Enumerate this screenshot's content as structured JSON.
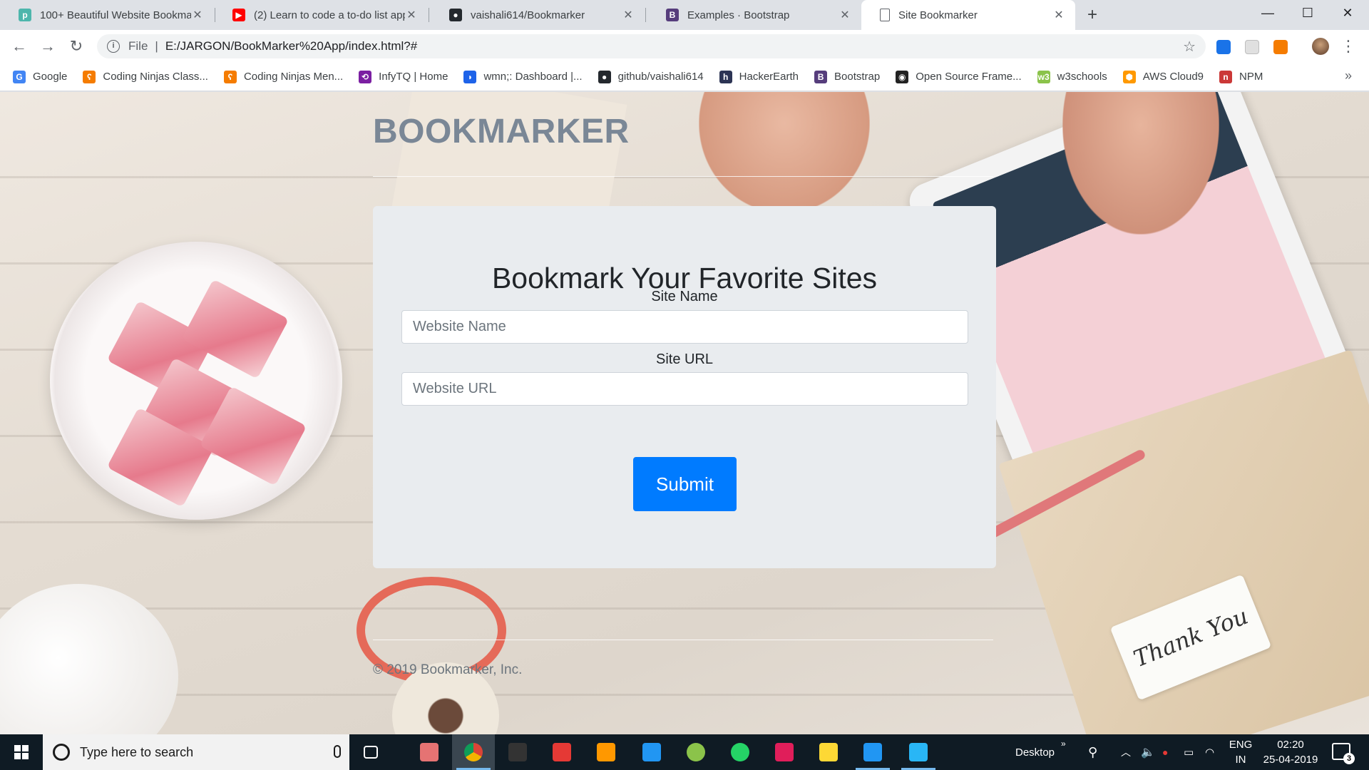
{
  "browser": {
    "tabs": [
      {
        "title": "100+ Beautiful Website Bookmar",
        "favicon": "portfolio-icon",
        "color": "#4db6ac",
        "glyph": "p",
        "active": false
      },
      {
        "title": "(2) Learn to code a to-do list app",
        "favicon": "youtube-icon",
        "color": "#ff0000",
        "glyph": "▶",
        "active": false
      },
      {
        "title": "vaishali614/Bookmarker",
        "favicon": "github-icon",
        "color": "#24292e",
        "glyph": "●",
        "active": false
      },
      {
        "title": "Examples · Bootstrap",
        "favicon": "bootstrap-icon",
        "color": "#563d7c",
        "glyph": "B",
        "active": false
      },
      {
        "title": "Site Bookmarker",
        "favicon": "page-icon",
        "color": "#ffffff",
        "glyph": "",
        "active": true
      }
    ],
    "new_tab": "+",
    "window_controls": {
      "minimize": "—",
      "maximize": "☐",
      "close": "✕"
    },
    "address": {
      "scheme": "File",
      "url": "E:/JARGON/BookMarker%20App/index.html?#"
    },
    "bookmarks": [
      {
        "label": "Google",
        "icon": "google-icon",
        "color": "#4285f4",
        "glyph": "G"
      },
      {
        "label": "Coding Ninjas Class...",
        "icon": "coding-ninjas-icon",
        "color": "#f57c00",
        "glyph": "ʕ"
      },
      {
        "label": "Coding Ninjas Men...",
        "icon": "coding-ninjas-icon",
        "color": "#f57c00",
        "glyph": "ʕ"
      },
      {
        "label": "InfyTQ | Home",
        "icon": "infytq-icon",
        "color": "#7b1fa2",
        "glyph": "⟲"
      },
      {
        "label": "wmn;: Dashboard |...",
        "icon": "wmn-icon",
        "color": "#1e63e9",
        "glyph": "◗"
      },
      {
        "label": "github/vaishali614",
        "icon": "github-icon",
        "color": "#24292e",
        "glyph": "●"
      },
      {
        "label": "HackerEarth",
        "icon": "hackerearth-icon",
        "color": "#2c3454",
        "glyph": "h"
      },
      {
        "label": "Bootstrap",
        "icon": "bootstrap-icon",
        "color": "#563d7c",
        "glyph": "B"
      },
      {
        "label": "Open Source Frame...",
        "icon": "opensource-icon",
        "color": "#222222",
        "glyph": "◉"
      },
      {
        "label": "w3schools",
        "icon": "w3schools-icon",
        "color": "#8bc34a",
        "glyph": "w3"
      },
      {
        "label": "AWS Cloud9",
        "icon": "aws-cloud9-icon",
        "color": "#ff9900",
        "glyph": "⬢"
      },
      {
        "label": "NPM",
        "icon": "npm-icon",
        "color": "#cb3837",
        "glyph": "n"
      }
    ],
    "bookmarks_more": "»"
  },
  "page": {
    "brand": "BOOKMARKER",
    "heading": "Bookmark Your Favorite Sites",
    "site_name_label": "Site Name",
    "site_name_placeholder": "Website Name",
    "site_url_label": "Site URL",
    "site_url_placeholder": "Website URL",
    "submit_label": "Submit",
    "footer": "© 2019 Bookmarker, Inc.",
    "tag_text": "Thank You",
    "colors": {
      "primary": "#007bff",
      "card": "#e9ecef",
      "brand_text": "#7a8796"
    }
  },
  "taskbar": {
    "search_placeholder": "Type here to search",
    "apps": [
      {
        "name": "task-view-icon",
        "color": "#ffffff",
        "active": false
      },
      {
        "name": "paint-icon",
        "color": "#e57373",
        "active": false
      },
      {
        "name": "chrome-icon",
        "color": "#4caf50",
        "active": true
      },
      {
        "name": "terminal-icon",
        "color": "#333333",
        "active": false
      },
      {
        "name": "app-grid-icon",
        "color": "#e53935",
        "active": false
      },
      {
        "name": "sublime-text-icon",
        "color": "#ff9800",
        "active": false
      },
      {
        "name": "vscode-icon",
        "color": "#2196f3",
        "active": false
      },
      {
        "name": "nodejs-icon",
        "color": "#8bc34a",
        "active": false
      },
      {
        "name": "whatsapp-icon",
        "color": "#25d366",
        "active": false
      },
      {
        "name": "slack-icon",
        "color": "#e01e5a",
        "active": false
      },
      {
        "name": "file-explorer-icon",
        "color": "#fdd835",
        "active": false
      },
      {
        "name": "vscode-icon",
        "color": "#2196f3",
        "active": true
      },
      {
        "name": "snipping-tool-icon",
        "color": "#29b6f6",
        "active": true
      }
    ],
    "desktop_label": "Desktop",
    "lang_1": "ENG",
    "lang_2": "IN",
    "time": "02:20",
    "date": "25-04-2019",
    "notifications": "3"
  }
}
